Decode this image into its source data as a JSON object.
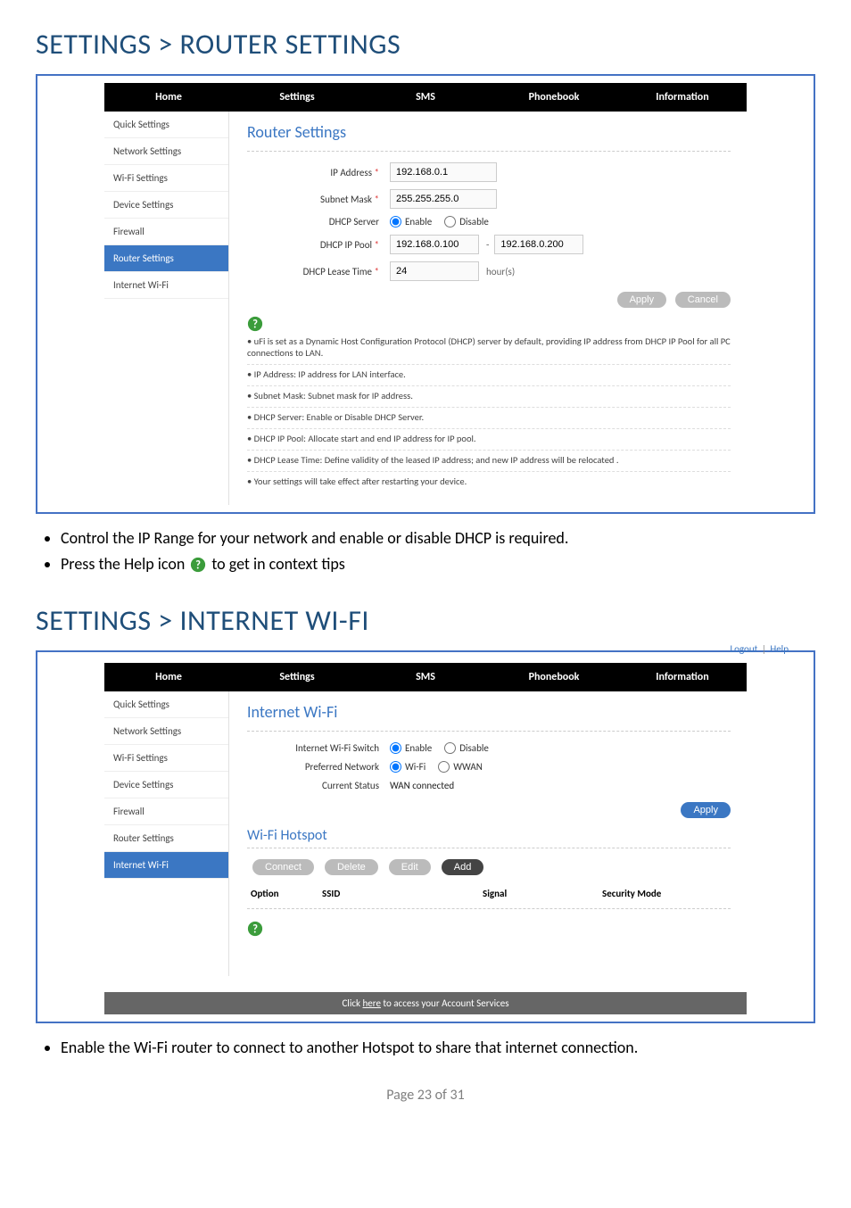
{
  "headings": {
    "section1": "SETTINGS > ROUTER SETTINGS",
    "section2": "SETTINGS > INTERNET WI-FI"
  },
  "nav": {
    "home": "Home",
    "settings": "Settings",
    "sms": "SMS",
    "phonebook": "Phonebook",
    "information": "Information"
  },
  "top_links": {
    "logout": "Logout",
    "help": "Help"
  },
  "sidebar": {
    "quick": "Quick Settings",
    "network": "Network Settings",
    "wifi": "Wi-Fi Settings",
    "device": "Device Settings",
    "firewall": "Firewall",
    "router": "Router Settings",
    "internet_wifi": "Internet Wi-Fi"
  },
  "router": {
    "title": "Router Settings",
    "labels": {
      "ip": "IP Address",
      "mask": "Subnet Mask",
      "dhcp": "DHCP Server",
      "pool": "DHCP IP Pool",
      "lease": "DHCP Lease Time"
    },
    "values": {
      "ip": "192.168.0.1",
      "mask": "255.255.255.0",
      "pool_start": "192.168.0.100",
      "pool_end": "192.168.0.200",
      "lease": "24",
      "hours": "hour(s)"
    },
    "radios": {
      "enable": "Enable",
      "disable": "Disable"
    },
    "buttons": {
      "apply": "Apply",
      "cancel": "Cancel"
    },
    "help": {
      "l1": "• uFi is set as a Dynamic Host Configuration Protocol (DHCP) server by default, providing IP address from DHCP IP Pool for all PC connections to LAN.",
      "l2": "• IP Address: IP address for LAN interface.",
      "l3": "• Subnet Mask: Subnet mask for IP address.",
      "l4": "• DHCP Server: Enable or Disable DHCP Server.",
      "l5": "• DHCP IP Pool: Allocate start and end IP address for IP pool.",
      "l6": "• DHCP Lease Time: Define validity of the leased IP address; and new IP address will be relocated .",
      "l7": "• Your settings will take effect after restarting your device."
    }
  },
  "iwifi": {
    "title": "Internet Wi-Fi",
    "labels": {
      "switch": "Internet Wi-Fi Switch",
      "preferred": "Preferred Network",
      "status": "Current Status"
    },
    "radios": {
      "enable": "Enable",
      "disable": "Disable",
      "wifi": "Wi-Fi",
      "wwan": "WWAN"
    },
    "status_value": "WAN connected",
    "apply": "Apply",
    "hotspot_title": "Wi-Fi Hotspot",
    "buttons": {
      "connect": "Connect",
      "delete": "Delete",
      "edit": "Edit",
      "add": "Add"
    },
    "table": {
      "option": "Option",
      "ssid": "SSID",
      "signal": "Signal",
      "security": "Security Mode"
    },
    "footer_pre": "Click ",
    "footer_link": "here",
    "footer_post": " to access your Account Services"
  },
  "doc_bullets": {
    "b1": "Control the IP Range for your network and enable or disable DHCP is required.",
    "b2a": "Press the Help icon ",
    "b2b": " to get in context tips",
    "b3": "Enable the Wi-Fi router to connect to another Hotspot to share that internet connection."
  },
  "page_footer": "Page 23 of 31"
}
